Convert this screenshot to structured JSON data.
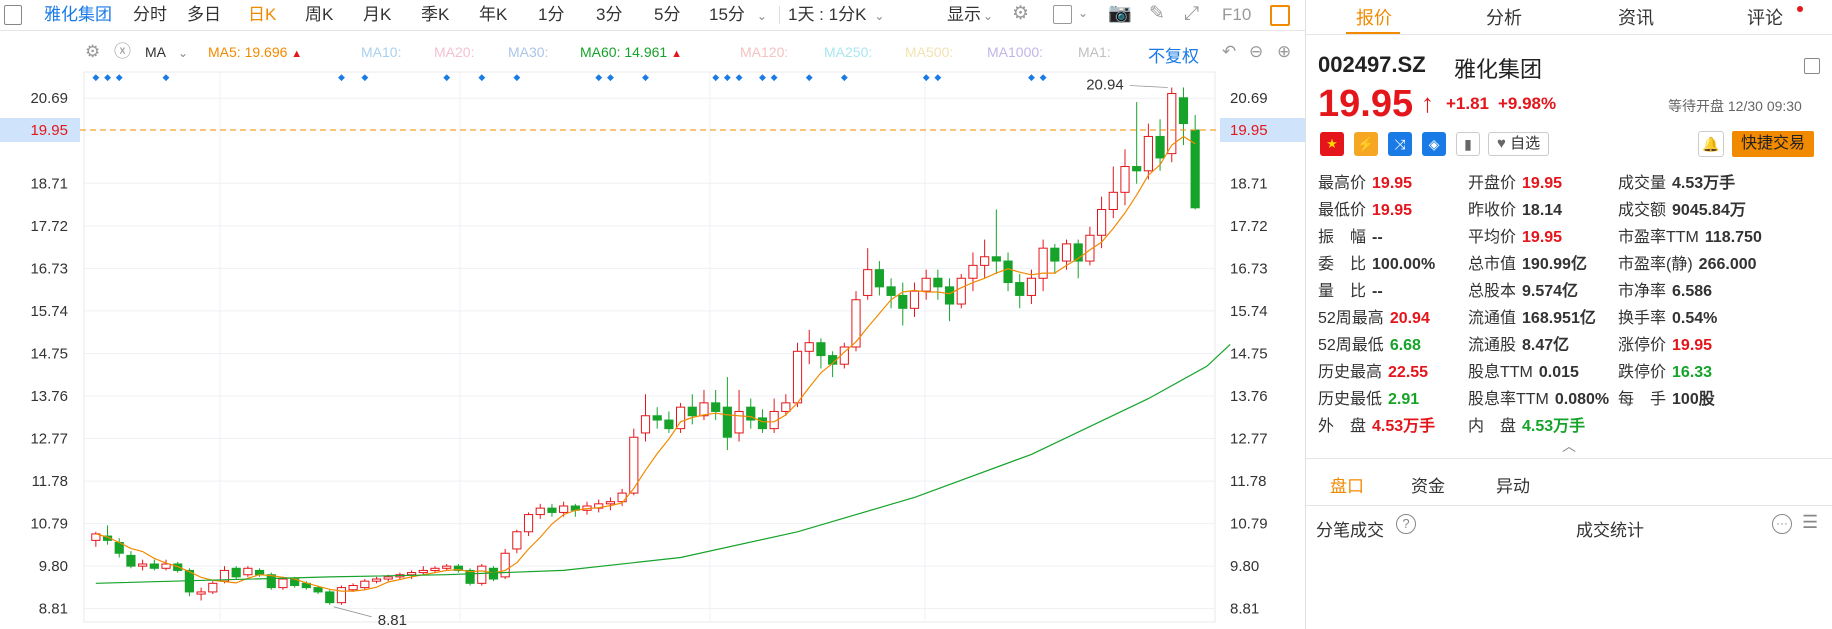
{
  "toolbar": {
    "name": "雅化集团",
    "periods": [
      "分时",
      "多日",
      "日K",
      "周K",
      "月K",
      "季K",
      "年K",
      "1分",
      "3分",
      "5分",
      "15分"
    ],
    "active_period": "日K",
    "range": "1天 : 1分K",
    "display": "显示",
    "f10": "F10"
  },
  "ma_row": {
    "ma_label": "MA",
    "ma5": "MA5: 19.696",
    "ma10": "MA10:",
    "ma20": "MA20:",
    "ma30": "MA30:",
    "ma60": "MA60: 14.961",
    "ma120": "MA120:",
    "ma250": "MA250:",
    "ma500": "MA500:",
    "ma1000": "MA1000:",
    "ma1": "MA1:",
    "adjust": "不复权",
    "colors": {
      "ma5": "#f28a00",
      "ma10": "#a8d0f0",
      "ma20": "#f3c2d0",
      "ma30": "#a9c6e8",
      "ma60": "#16a32a",
      "ma120": "#f3c2c2",
      "ma250": "#a8e6f0",
      "ma500": "#f3e2b0",
      "ma1000": "#c2b6e8",
      "ma1": "#c0c0c0"
    }
  },
  "chart_data": {
    "type": "candlestick",
    "ylim": [
      8.5,
      21.3
    ],
    "y_ticks": [
      "20.69",
      "19.95",
      "18.71",
      "17.72",
      "16.73",
      "15.74",
      "14.75",
      "13.76",
      "12.77",
      "11.78",
      "10.79",
      "9.80",
      "8.81"
    ],
    "current_price_label": "19.95",
    "current_price": 19.95,
    "high_label": "20.94",
    "low_label": "8.81",
    "candles": [
      [
        10.4,
        10.55,
        10.25,
        10.6
      ],
      [
        10.5,
        10.4,
        10.3,
        10.75
      ],
      [
        10.35,
        10.1,
        10.0,
        10.45
      ],
      [
        10.05,
        9.8,
        9.75,
        10.15
      ],
      [
        9.8,
        9.85,
        9.7,
        9.95
      ],
      [
        9.85,
        9.75,
        9.7,
        9.95
      ],
      [
        9.75,
        9.85,
        9.7,
        9.95
      ],
      [
        9.85,
        9.7,
        9.65,
        9.9
      ],
      [
        9.7,
        9.2,
        9.1,
        9.75
      ],
      [
        9.15,
        9.2,
        9.0,
        9.3
      ],
      [
        9.2,
        9.4,
        9.15,
        9.45
      ],
      [
        9.45,
        9.7,
        9.4,
        9.8
      ],
      [
        9.75,
        9.55,
        9.5,
        9.8
      ],
      [
        9.6,
        9.75,
        9.55,
        9.8
      ],
      [
        9.7,
        9.6,
        9.55,
        9.75
      ],
      [
        9.6,
        9.3,
        9.25,
        9.65
      ],
      [
        9.3,
        9.5,
        9.25,
        9.55
      ],
      [
        9.5,
        9.35,
        9.3,
        9.55
      ],
      [
        9.4,
        9.3,
        9.25,
        9.45
      ],
      [
        9.3,
        9.2,
        9.15,
        9.35
      ],
      [
        9.2,
        8.95,
        8.9,
        9.25
      ],
      [
        8.95,
        9.3,
        8.9,
        9.35
      ],
      [
        9.25,
        9.35,
        9.2,
        9.4
      ],
      [
        9.3,
        9.45,
        9.25,
        9.5
      ],
      [
        9.45,
        9.5,
        9.4,
        9.55
      ],
      [
        9.5,
        9.55,
        9.45,
        9.6
      ],
      [
        9.55,
        9.6,
        9.5,
        9.65
      ],
      [
        9.6,
        9.65,
        9.5,
        9.7
      ],
      [
        9.65,
        9.7,
        9.6,
        9.8
      ],
      [
        9.7,
        9.75,
        9.65,
        9.8
      ],
      [
        9.75,
        9.8,
        9.7,
        9.85
      ],
      [
        9.8,
        9.7,
        9.65,
        9.85
      ],
      [
        9.7,
        9.4,
        9.35,
        9.75
      ],
      [
        9.4,
        9.8,
        9.35,
        9.85
      ],
      [
        9.75,
        9.5,
        9.45,
        9.8
      ],
      [
        9.55,
        10.1,
        9.5,
        10.2
      ],
      [
        10.2,
        10.6,
        10.1,
        10.65
      ],
      [
        10.6,
        11.0,
        10.5,
        11.05
      ],
      [
        11.0,
        11.15,
        10.9,
        11.25
      ],
      [
        11.15,
        11.05,
        10.95,
        11.25
      ],
      [
        11.05,
        11.2,
        10.95,
        11.3
      ],
      [
        11.2,
        11.1,
        10.95,
        11.25
      ],
      [
        11.1,
        11.2,
        11.0,
        11.3
      ],
      [
        11.15,
        11.25,
        11.05,
        11.35
      ],
      [
        11.25,
        11.3,
        11.1,
        11.4
      ],
      [
        11.3,
        11.5,
        11.2,
        11.6
      ],
      [
        11.5,
        12.8,
        11.45,
        13.0
      ],
      [
        12.9,
        13.3,
        12.7,
        13.8
      ],
      [
        13.3,
        13.2,
        13.0,
        13.5
      ],
      [
        13.2,
        13.0,
        12.9,
        13.4
      ],
      [
        13.0,
        13.5,
        12.9,
        13.6
      ],
      [
        13.5,
        13.3,
        13.1,
        13.8
      ],
      [
        13.3,
        13.6,
        13.2,
        13.9
      ],
      [
        13.6,
        13.4,
        13.2,
        13.9
      ],
      [
        13.5,
        12.8,
        12.5,
        14.2
      ],
      [
        12.9,
        13.4,
        12.7,
        13.9
      ],
      [
        13.5,
        13.2,
        13.0,
        13.7
      ],
      [
        13.25,
        13.0,
        12.9,
        13.45
      ],
      [
        13.0,
        13.4,
        12.9,
        13.7
      ],
      [
        13.4,
        13.6,
        13.3,
        13.8
      ],
      [
        13.6,
        14.8,
        13.5,
        15.0
      ],
      [
        14.8,
        15.0,
        14.5,
        15.3
      ],
      [
        15.0,
        14.7,
        14.4,
        15.1
      ],
      [
        14.7,
        14.5,
        14.2,
        14.8
      ],
      [
        14.5,
        14.9,
        14.4,
        15.0
      ],
      [
        14.9,
        16.0,
        14.8,
        16.2
      ],
      [
        16.1,
        16.7,
        16.0,
        17.2
      ],
      [
        16.7,
        16.3,
        16.1,
        16.9
      ],
      [
        16.3,
        16.1,
        15.8,
        16.5
      ],
      [
        16.1,
        15.8,
        15.4,
        16.4
      ],
      [
        15.8,
        16.2,
        15.6,
        16.4
      ],
      [
        16.2,
        16.5,
        16.0,
        16.7
      ],
      [
        16.5,
        16.3,
        16.0,
        16.7
      ],
      [
        16.3,
        15.9,
        15.5,
        16.5
      ],
      [
        15.9,
        16.5,
        15.8,
        16.6
      ],
      [
        16.5,
        16.8,
        16.2,
        17.1
      ],
      [
        16.8,
        17.0,
        16.5,
        17.4
      ],
      [
        17.0,
        16.9,
        16.6,
        18.1
      ],
      [
        16.9,
        16.4,
        16.2,
        17.1
      ],
      [
        16.4,
        16.1,
        15.8,
        16.6
      ],
      [
        16.1,
        16.5,
        15.9,
        16.7
      ],
      [
        16.5,
        17.2,
        16.2,
        17.4
      ],
      [
        17.2,
        16.9,
        16.6,
        17.3
      ],
      [
        16.9,
        17.3,
        16.7,
        17.4
      ],
      [
        17.3,
        16.9,
        16.5,
        17.4
      ],
      [
        16.9,
        17.5,
        16.8,
        17.7
      ],
      [
        17.5,
        18.1,
        17.2,
        18.4
      ],
      [
        18.1,
        18.5,
        17.9,
        19.1
      ],
      [
        18.5,
        19.1,
        18.2,
        19.5
      ],
      [
        19.1,
        19.0,
        18.7,
        20.6
      ],
      [
        19.0,
        19.8,
        18.8,
        20.1
      ],
      [
        19.8,
        19.3,
        19.0,
        20.2
      ],
      [
        19.4,
        20.8,
        19.2,
        20.94
      ],
      [
        20.7,
        20.1,
        19.6,
        20.94
      ],
      [
        19.95,
        18.14,
        18.1,
        20.3
      ]
    ],
    "ma60": [
      [
        0,
        9.4
      ],
      [
        20,
        9.55
      ],
      [
        30,
        9.6
      ],
      [
        40,
        9.7
      ],
      [
        50,
        10.0
      ],
      [
        60,
        10.6
      ],
      [
        70,
        11.4
      ],
      [
        80,
        12.4
      ],
      [
        90,
        13.7
      ],
      [
        95,
        14.45
      ],
      [
        97,
        14.96
      ]
    ],
    "ma5_color": "#f28a00",
    "ma60_color": "#16a32a",
    "up_color": "#e4151b",
    "down_color": "#16a32a",
    "markers": "◆"
  },
  "panel": {
    "tabs": [
      "报价",
      "分析",
      "资讯",
      "评论"
    ],
    "active_tab": "报价",
    "code": "002497.SZ",
    "name": "雅化集团",
    "price": "19.95",
    "arrow": "↑",
    "change": "+1.81",
    "change_pct": "+9.98%",
    "status": "等待开盘 12/30 09:30",
    "watch_label": "自选",
    "trade_label": "快捷交易",
    "fields": [
      [
        {
          "k": "最高价",
          "v": "19.95",
          "c": "red"
        },
        {
          "k": "开盘价",
          "v": "19.95",
          "c": "red"
        },
        {
          "k": "成交量",
          "v": "4.53万手",
          "c": ""
        }
      ],
      [
        {
          "k": "最低价",
          "v": "19.95",
          "c": "red"
        },
        {
          "k": "昨收价",
          "v": "18.14",
          "c": ""
        },
        {
          "k": "成交额",
          "v": "9045.84万",
          "c": ""
        }
      ],
      [
        {
          "k": "振　幅",
          "v": "--",
          "c": ""
        },
        {
          "k": "平均价",
          "v": "19.95",
          "c": "red"
        },
        {
          "k": "市盈率TTM",
          "v": "118.750",
          "c": ""
        }
      ],
      [
        {
          "k": "委　比",
          "v": "100.00%",
          "c": ""
        },
        {
          "k": "总市值",
          "v": "190.99亿",
          "c": ""
        },
        {
          "k": "市盈率(静)",
          "v": "266.000",
          "c": ""
        }
      ],
      [
        {
          "k": "量　比",
          "v": "--",
          "c": ""
        },
        {
          "k": "总股本",
          "v": "9.574亿",
          "c": ""
        },
        {
          "k": "市净率",
          "v": "6.586",
          "c": ""
        }
      ],
      [
        {
          "k": "52周最高",
          "v": "20.94",
          "c": "red"
        },
        {
          "k": "流通值",
          "v": "168.951亿",
          "c": ""
        },
        {
          "k": "换手率",
          "v": "0.54%",
          "c": ""
        }
      ],
      [
        {
          "k": "52周最低",
          "v": "6.68",
          "c": "green"
        },
        {
          "k": "流通股",
          "v": "8.47亿",
          "c": ""
        },
        {
          "k": "涨停价",
          "v": "19.95",
          "c": "red"
        }
      ],
      [
        {
          "k": "历史最高",
          "v": "22.55",
          "c": "red"
        },
        {
          "k": "股息TTM",
          "v": "0.015",
          "c": ""
        },
        {
          "k": "跌停价",
          "v": "16.33",
          "c": "green"
        }
      ],
      [
        {
          "k": "历史最低",
          "v": "2.91",
          "c": "green"
        },
        {
          "k": "股息率TTM",
          "v": "0.080%",
          "c": ""
        },
        {
          "k": "每　手",
          "v": "100股",
          "c": ""
        }
      ],
      [
        {
          "k": "外　盘",
          "v": "4.53万手",
          "c": "red"
        },
        {
          "k": "内　盘",
          "v": "4.53万手",
          "c": "green"
        },
        {
          "k": "",
          "v": "",
          "c": ""
        }
      ]
    ],
    "subtabs": [
      "盘口",
      "资金",
      "异动"
    ],
    "active_subtab": "盘口",
    "ticks_label": "分笔成交",
    "stats_label": "成交统计"
  }
}
